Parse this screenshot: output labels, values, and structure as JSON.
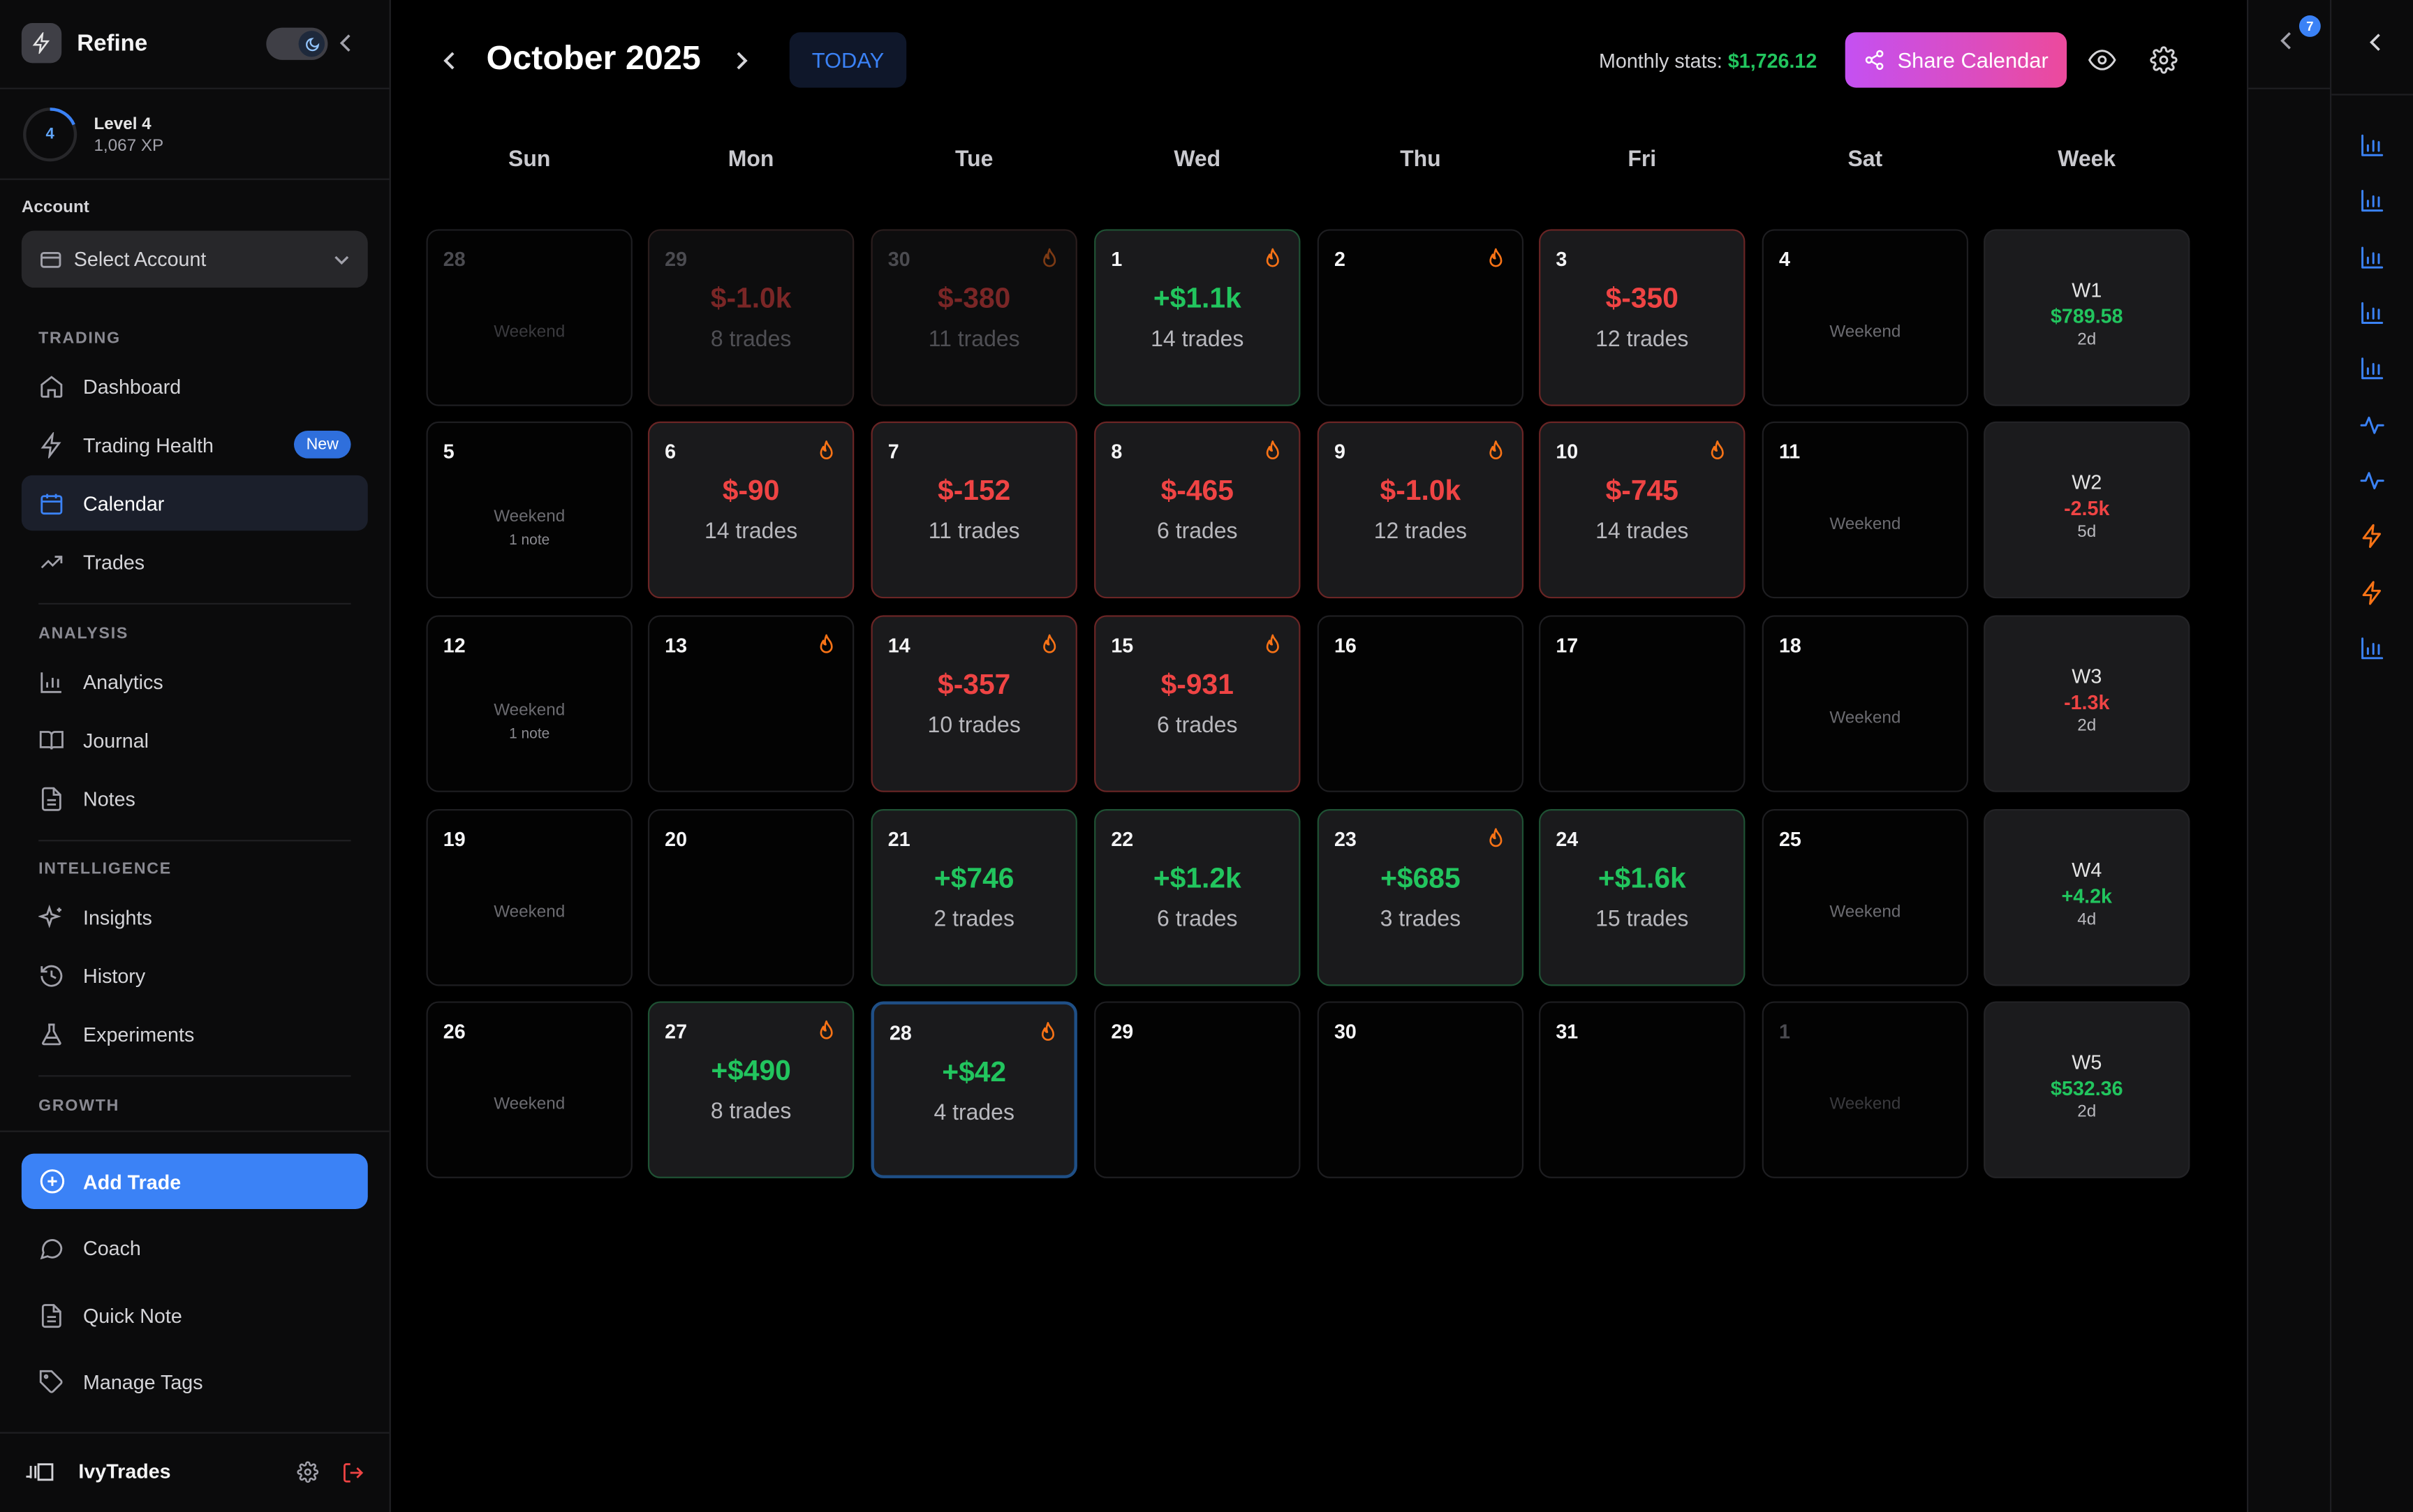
{
  "app": {
    "name": "Refine"
  },
  "level": {
    "value": "4",
    "label": "Level 4",
    "xp": "1,067 XP"
  },
  "account": {
    "label": "Account",
    "placeholder": "Select Account"
  },
  "sidebar": {
    "sections": [
      {
        "label": "TRADING"
      },
      {
        "label": "ANALYSIS"
      },
      {
        "label": "INTELLIGENCE"
      },
      {
        "label": "GROWTH"
      }
    ],
    "items": [
      {
        "label": "Dashboard"
      },
      {
        "label": "Trading Health",
        "badge": "New"
      },
      {
        "label": "Calendar"
      },
      {
        "label": "Trades"
      },
      {
        "label": "Analytics"
      },
      {
        "label": "Journal"
      },
      {
        "label": "Notes"
      },
      {
        "label": "Insights"
      },
      {
        "label": "History"
      },
      {
        "label": "Experiments"
      }
    ],
    "add_trade": "Add Trade",
    "bottom": [
      {
        "label": "Coach"
      },
      {
        "label": "Quick Note"
      },
      {
        "label": "Manage Tags"
      }
    ],
    "user": "IvyTrades"
  },
  "header": {
    "month": "October 2025",
    "today": "TODAY",
    "stats_label": "Monthly stats:",
    "stats_value": "$1,726.12",
    "share": "Share Calendar"
  },
  "weekdays": [
    "Sun",
    "Mon",
    "Tue",
    "Wed",
    "Thu",
    "Fri",
    "Sat",
    "Week"
  ],
  "weeks": [
    {
      "days": [
        {
          "day": "28",
          "out": true,
          "weekend": "Weekend"
        },
        {
          "day": "29",
          "out": true,
          "pnl": "$-1.0k",
          "trades": "8 trades",
          "kind": "loss"
        },
        {
          "day": "30",
          "out": true,
          "pnl": "$-380",
          "trades": "11 trades",
          "kind": "loss",
          "flame": true
        },
        {
          "day": "1",
          "pnl": "+$1.1k",
          "trades": "14 trades",
          "kind": "gain",
          "flame": true
        },
        {
          "day": "2",
          "flame": true
        },
        {
          "day": "3",
          "pnl": "$-350",
          "trades": "12 trades",
          "kind": "loss"
        },
        {
          "day": "4",
          "weekend": "Weekend"
        }
      ],
      "summary": {
        "label": "W1",
        "value": "$789.58",
        "days": "2d",
        "sign": "pos"
      }
    },
    {
      "days": [
        {
          "day": "5",
          "weekend": "Weekend",
          "note": "1 note"
        },
        {
          "day": "6",
          "pnl": "$-90",
          "trades": "14 trades",
          "kind": "loss",
          "flame": true
        },
        {
          "day": "7",
          "pnl": "$-152",
          "trades": "11 trades",
          "kind": "loss"
        },
        {
          "day": "8",
          "pnl": "$-465",
          "trades": "6 trades",
          "kind": "loss",
          "flame": true
        },
        {
          "day": "9",
          "pnl": "$-1.0k",
          "trades": "12 trades",
          "kind": "loss",
          "flame": true
        },
        {
          "day": "10",
          "pnl": "$-745",
          "trades": "14 trades",
          "kind": "loss",
          "flame": true
        },
        {
          "day": "11",
          "weekend": "Weekend"
        }
      ],
      "summary": {
        "label": "W2",
        "value": "-2.5k",
        "days": "5d",
        "sign": "neg"
      }
    },
    {
      "days": [
        {
          "day": "12",
          "weekend": "Weekend",
          "note": "1 note"
        },
        {
          "day": "13",
          "flame": true
        },
        {
          "day": "14",
          "pnl": "$-357",
          "trades": "10 trades",
          "kind": "loss",
          "flame": true
        },
        {
          "day": "15",
          "pnl": "$-931",
          "trades": "6 trades",
          "kind": "loss",
          "flame": true
        },
        {
          "day": "16"
        },
        {
          "day": "17"
        },
        {
          "day": "18",
          "weekend": "Weekend"
        }
      ],
      "summary": {
        "label": "W3",
        "value": "-1.3k",
        "days": "2d",
        "sign": "neg"
      }
    },
    {
      "days": [
        {
          "day": "19",
          "weekend": "Weekend"
        },
        {
          "day": "20"
        },
        {
          "day": "21",
          "pnl": "+$746",
          "trades": "2 trades",
          "kind": "gain"
        },
        {
          "day": "22",
          "pnl": "+$1.2k",
          "trades": "6 trades",
          "kind": "gain"
        },
        {
          "day": "23",
          "pnl": "+$685",
          "trades": "3 trades",
          "kind": "gain",
          "flame": true
        },
        {
          "day": "24",
          "pnl": "+$1.6k",
          "trades": "15 trades",
          "kind": "gain"
        },
        {
          "day": "25",
          "weekend": "Weekend"
        }
      ],
      "summary": {
        "label": "W4",
        "value": "+4.2k",
        "days": "4d",
        "sign": "pos"
      }
    },
    {
      "days": [
        {
          "day": "26",
          "weekend": "Weekend"
        },
        {
          "day": "27",
          "pnl": "+$490",
          "trades": "8 trades",
          "kind": "gain",
          "flame": true
        },
        {
          "day": "28",
          "pnl": "+$42",
          "trades": "4 trades",
          "kind": "gain",
          "flame": true,
          "today": true
        },
        {
          "day": "29"
        },
        {
          "day": "30"
        },
        {
          "day": "31"
        },
        {
          "day": "1",
          "out": true,
          "weekend": "Weekend"
        }
      ],
      "summary": {
        "label": "W5",
        "value": "$532.36",
        "days": "2d",
        "sign": "pos"
      }
    }
  ],
  "notifications": "7",
  "colors": {
    "gain": "#22c55e",
    "loss": "#ef4444",
    "accent": "#3b82f6",
    "flame": "#f97316",
    "rail_icon": "#3b82f6"
  },
  "rail_icons": [
    "bar-chart-icon",
    "bar-chart-icon",
    "bar-chart-icon",
    "bar-chart-icon",
    "bar-chart-icon",
    "pulse-icon",
    "pulse-icon",
    "bolt-icon",
    "bolt-icon",
    "bar-chart-icon"
  ]
}
